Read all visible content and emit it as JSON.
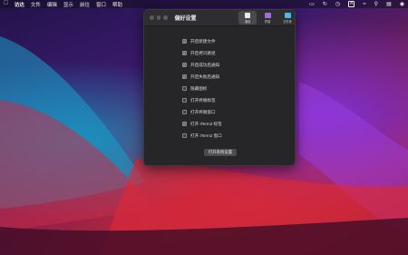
{
  "menubar": {
    "apple_icon": "apple-logo-icon",
    "items": [
      "访达",
      "文件",
      "编辑",
      "显示",
      "前往",
      "窗口",
      "帮助"
    ],
    "status_icons": [
      "screen-mirror-icon",
      "time-machine-icon",
      "clock-icon",
      "keyboard-input-icon",
      "wifi-icon",
      "search-icon",
      "control-center-icon",
      "siri-icon"
    ],
    "input_label": "A"
  },
  "window": {
    "title": "偏好设置",
    "tabs": [
      {
        "label": "通用",
        "icon": "general-icon",
        "active": true
      },
      {
        "label": "终端",
        "icon": "terminal-icon",
        "active": false
      },
      {
        "label": "文件夹",
        "icon": "folder-icon",
        "active": false
      }
    ],
    "options": [
      {
        "label": "开启新建文件",
        "checked": true
      },
      {
        "label": "开启拷贝路径",
        "checked": true
      },
      {
        "label": "开启成功后通知",
        "checked": true
      },
      {
        "label": "开启失败后通知",
        "checked": true
      },
      {
        "label": "隐藏图标",
        "checked": false
      },
      {
        "label": "打开终端标签",
        "checked": false
      },
      {
        "label": "打开终端窗口",
        "checked": false
      },
      {
        "label": "打开 iTerm2 标签",
        "checked": true
      },
      {
        "label": "打开 iTerm2 窗口",
        "checked": false
      }
    ],
    "open_settings_label": "打开系统设置"
  }
}
